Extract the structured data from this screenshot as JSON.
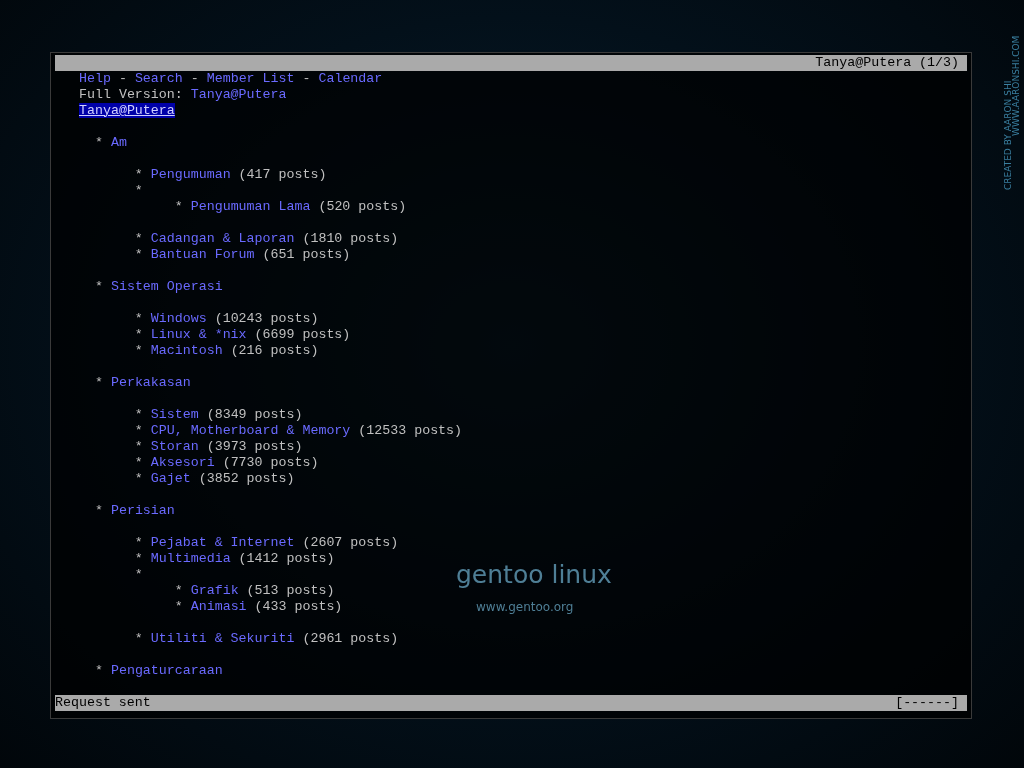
{
  "window": {
    "title": "Tanya@Putera (1/3)"
  },
  "nav": [
    {
      "kind": "link",
      "text": "Help"
    },
    {
      "kind": "separator",
      "text": "-"
    },
    {
      "kind": "link",
      "text": "Search"
    },
    {
      "kind": "separator",
      "text": "-"
    },
    {
      "kind": "link",
      "text": "Member List"
    },
    {
      "kind": "separator",
      "text": "-"
    },
    {
      "kind": "link",
      "text": "Calendar"
    }
  ],
  "full_version": {
    "label": "Full Version:",
    "link": "Tanya@Putera"
  },
  "current_link": {
    "text": "Tanya@Putera",
    "selected": true
  },
  "categories": [
    {
      "bullet": "*",
      "name": "Am",
      "forums": [
        {
          "bullet": "*",
          "name": "Pengumuman",
          "count": "(417 posts)"
        },
        {
          "bullet": "*",
          "children": [
            {
              "bullet": "*",
              "name": "Pengumuman Lama",
              "count": "(520 posts)"
            }
          ]
        },
        {
          "bullet": "*",
          "name": "Cadangan & Laporan",
          "count": "(1810 posts)"
        },
        {
          "bullet": "*",
          "name": "Bantuan Forum",
          "count": "(651 posts)"
        }
      ]
    },
    {
      "bullet": "*",
      "name": "Sistem Operasi",
      "forums": [
        {
          "bullet": "*",
          "name": "Windows",
          "count": "(10243 posts)"
        },
        {
          "bullet": "*",
          "name": "Linux & *nix",
          "count": "(6699 posts)"
        },
        {
          "bullet": "*",
          "name": "Macintosh",
          "count": "(216 posts)"
        }
      ]
    },
    {
      "bullet": "*",
      "name": "Perkakasan",
      "forums": [
        {
          "bullet": "*",
          "name": "Sistem",
          "count": "(8349 posts)"
        },
        {
          "bullet": "*",
          "name": "CPU, Motherboard & Memory",
          "count": "(12533 posts)"
        },
        {
          "bullet": "*",
          "name": "Storan",
          "count": "(3973 posts)"
        },
        {
          "bullet": "*",
          "name": "Aksesori",
          "count": "(7730 posts)"
        },
        {
          "bullet": "*",
          "name": "Gajet",
          "count": "(3852 posts)"
        }
      ]
    },
    {
      "bullet": "*",
      "name": "Perisian",
      "forums": [
        {
          "bullet": "*",
          "name": "Pejabat & Internet",
          "count": "(2607 posts)"
        },
        {
          "bullet": "*",
          "name": "Multimedia",
          "count": "(1412 posts)"
        },
        {
          "bullet": "*",
          "children": [
            {
              "bullet": "*",
              "name": "Grafik",
              "count": "(513 posts)"
            },
            {
              "bullet": "*",
              "name": "Animasi",
              "count": "(433 posts)"
            }
          ]
        },
        {
          "bullet": "*",
          "name": "Utiliti & Sekuriti",
          "count": "(2961 posts)"
        }
      ]
    },
    {
      "bullet": "*",
      "name": "Pengaturcaraan"
    }
  ],
  "status_bar": {
    "message": "Request sent",
    "progress": "[------]"
  },
  "wallpaper": {
    "logo": "gentoo linux",
    "url": "www.gentoo.org",
    "credit": "CREATED BY AARON SHI",
    "site": "WWW.AARONSHI.COM"
  }
}
